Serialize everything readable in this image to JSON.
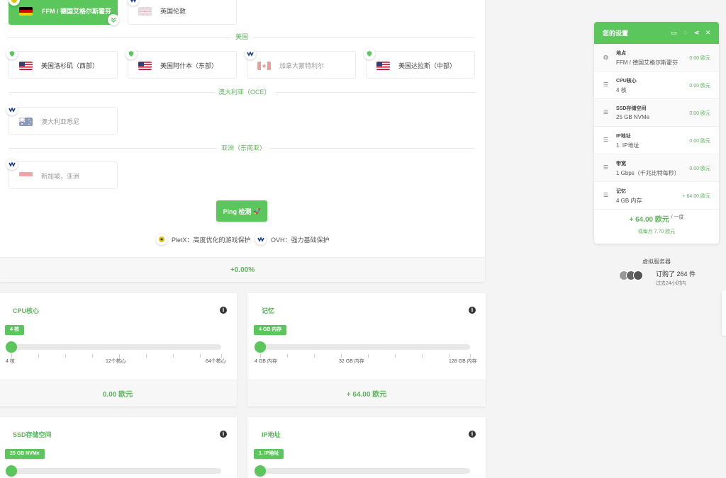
{
  "locations": {
    "selected": {
      "label": "FFM / 德国艾格尔斯霍芬"
    },
    "uk": {
      "label": "英国伦敦"
    },
    "regions": {
      "us": "美国",
      "oce": "澳大利亚（OCE）",
      "asia": "亚洲（东南亚）"
    },
    "us_items": [
      {
        "label": "美国洛杉矶（西部）"
      },
      {
        "label": "美国阿什本（东部）"
      },
      {
        "label": "加拿大蒙特利尔"
      },
      {
        "label": "美国达拉斯（中部）"
      }
    ],
    "oce_item": {
      "label": "澳大利亚悉尼"
    },
    "asia_item": {
      "label": "新加坡，亚洲"
    }
  },
  "ping_button": "Ping 检测",
  "legend": {
    "pletx": "PletX：高度优化的游戏保护",
    "ovh": "OVH：强力基础保护"
  },
  "location_surcharge": "+0.00%",
  "config": {
    "cpu": {
      "title": "CPU核心",
      "value_label": "4 核",
      "level": 0,
      "scale": [
        "4 核",
        "12个核心",
        "64个核心"
      ],
      "price": "0.00 欧元"
    },
    "ram": {
      "title": "记忆",
      "value_label": "4 GB 内存",
      "level": 0,
      "scale": [
        "4 GB 内存",
        "32 GB 内存",
        "128 GB 内存"
      ],
      "price": "+ 64.00 欧元"
    },
    "ssd": {
      "title": "SSD存储空间",
      "value_label": "25 GB NVMe",
      "level": 0
    },
    "ip": {
      "title": "IP地址",
      "value_label": "1. IP地址",
      "level": 0
    }
  },
  "settings": {
    "title": "您的设置",
    "rows": [
      {
        "key": "地点",
        "value": "FFM / 德国艾格尔斯霍芬",
        "price": "0.00 欧元",
        "icon": "globe-icon"
      },
      {
        "key": "CPU核心",
        "value": "4 核",
        "price": "0.00 欧元",
        "icon": "list-icon"
      },
      {
        "key": "SSD存储空间",
        "value": "25 GB NVMe",
        "price": "0.00 欧元",
        "icon": "list-icon"
      },
      {
        "key": "IP地址",
        "value": "1. IP地址",
        "price": "0.00 欧元",
        "icon": "list-icon"
      },
      {
        "key": "带宽",
        "value": "1 Gbps（千兆比特每秒）",
        "price": "0.00 欧元",
        "icon": "list-icon"
      },
      {
        "key": "记忆",
        "value": "4 GB 内存",
        "price": "+ 64.00 欧元",
        "icon": "list-icon"
      }
    ],
    "total": "+ 64.00 欧元",
    "period": "/ 一度",
    "monthly": "或每月 7.70 欧元"
  },
  "stats": {
    "product": "虚拟服务器",
    "ordered": "订购了 264 件",
    "window": "过去24小时内"
  },
  "colors": {
    "accent": "#5bc65b",
    "accent_text": "#5bb55b"
  }
}
